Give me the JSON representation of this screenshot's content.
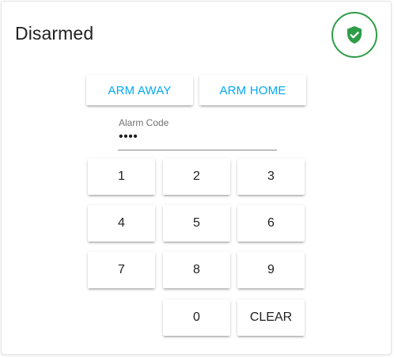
{
  "alarm": {
    "state_label": "Disarmed",
    "status_icon": "shield-check-icon",
    "status_color": "#2e9d47"
  },
  "actions": {
    "arm_away_label": "ARM AWAY",
    "arm_home_label": "ARM HOME",
    "accent_color": "#03a9f4"
  },
  "code_input": {
    "label": "Alarm Code",
    "value": "••••"
  },
  "keypad": {
    "key_1": "1",
    "key_2": "2",
    "key_3": "3",
    "key_4": "4",
    "key_5": "5",
    "key_6": "6",
    "key_7": "7",
    "key_8": "8",
    "key_9": "9",
    "key_0": "0",
    "clear_label": "CLEAR"
  }
}
